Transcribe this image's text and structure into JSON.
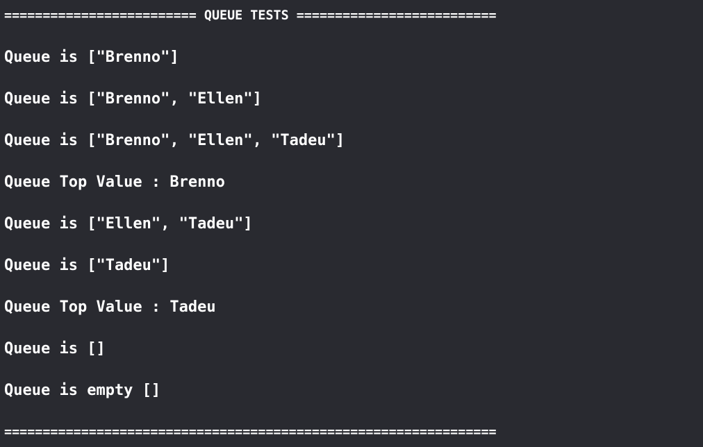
{
  "console": {
    "header": "========================= QUEUE TESTS ==========================",
    "lines": [
      "Queue is [\"Brenno\"]",
      "Queue is [\"Brenno\", \"Ellen\"]",
      "Queue is [\"Brenno\", \"Ellen\", \"Tadeu\"]",
      "Queue Top Value : Brenno",
      "Queue is [\"Ellen\", \"Tadeu\"]",
      "Queue is [\"Tadeu\"]",
      "Queue Top Value : Tadeu",
      "Queue is []",
      "Queue is empty []"
    ],
    "footer": "================================================================",
    "colors": {
      "background": "#292a30",
      "text": "#ffffff"
    }
  }
}
